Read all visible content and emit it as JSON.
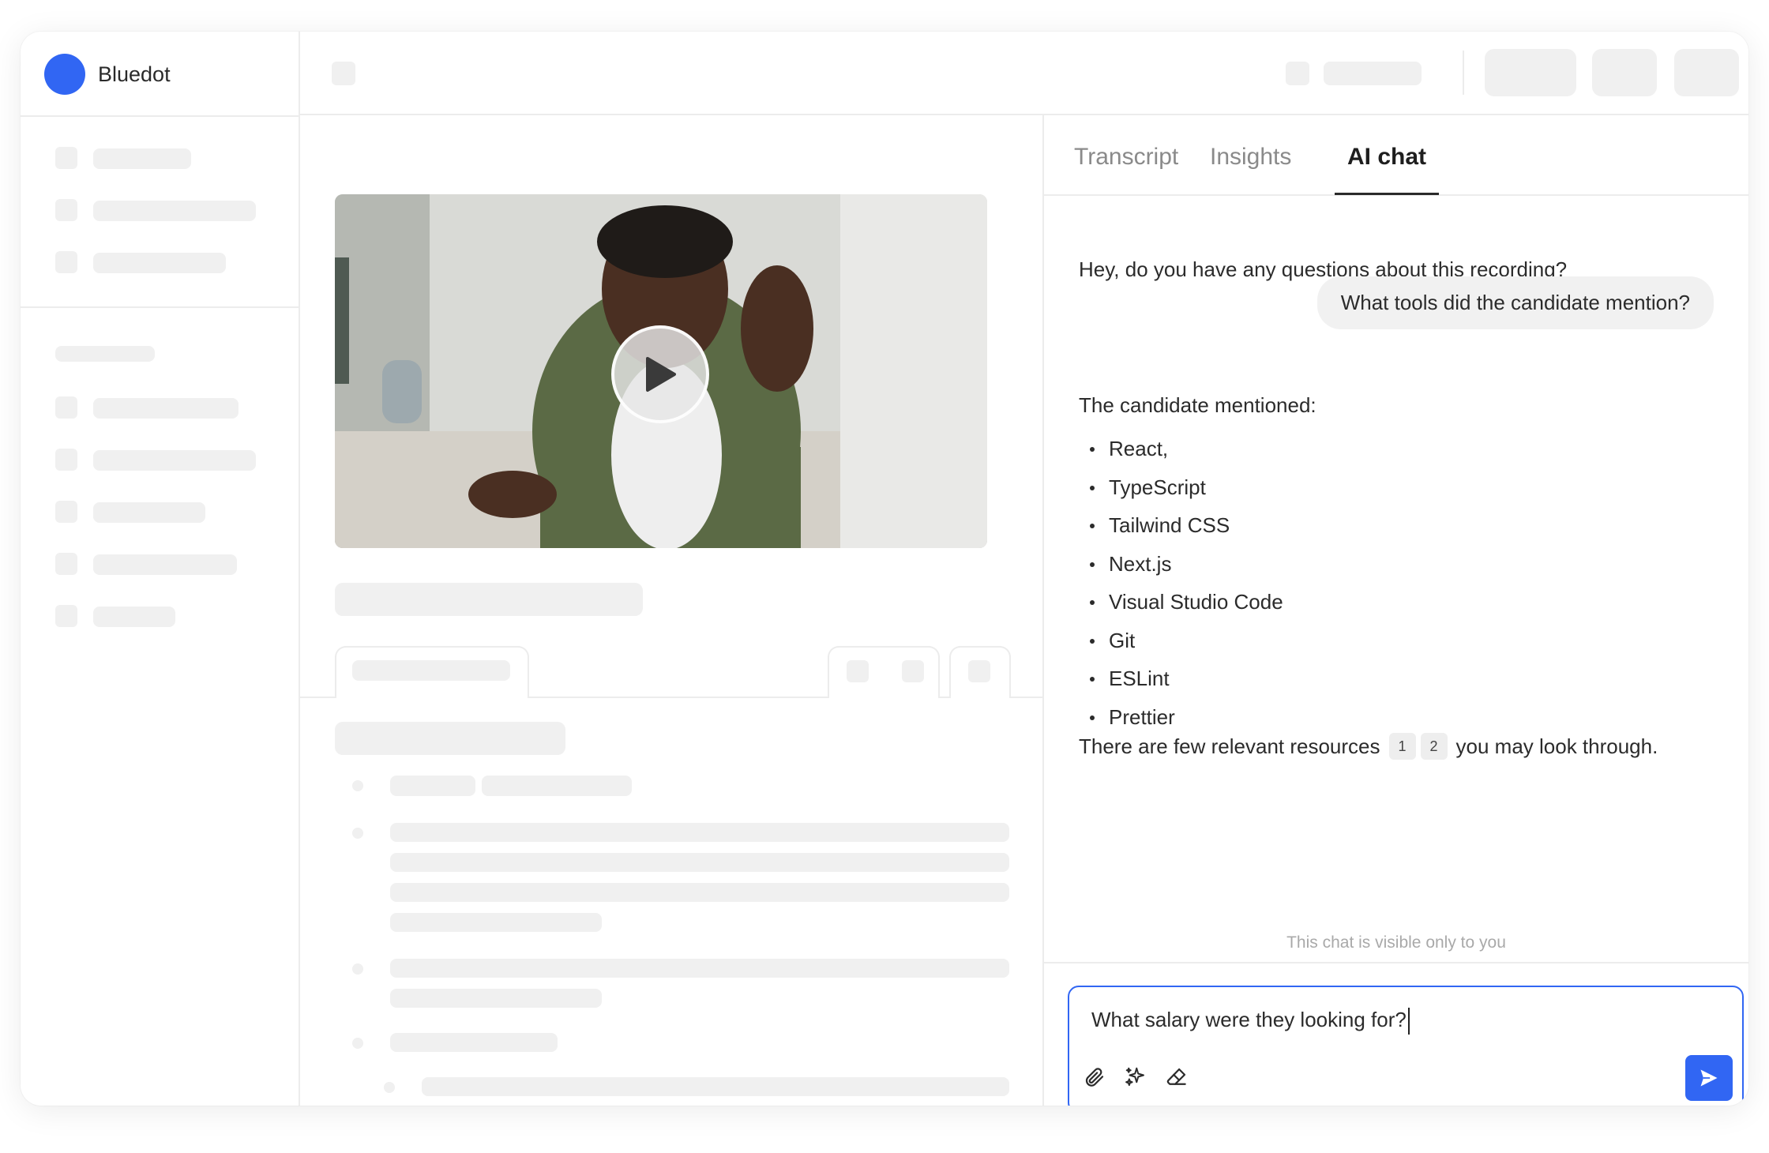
{
  "app": {
    "name": "Bluedot",
    "brand_color": "#3166f3"
  },
  "tabs": [
    {
      "label": "Transcript",
      "active": false
    },
    {
      "label": "Insights",
      "active": false
    },
    {
      "label": "AI chat",
      "active": true
    }
  ],
  "video": {
    "play_icon": "play-icon"
  },
  "chat": {
    "greeting": "Hey, do you have any questions about this recording?",
    "user_question": "What tools did the candidate mention?",
    "answer_intro": "The candidate mentioned:",
    "tools": [
      "React,",
      "TypeScript",
      "Tailwind CSS",
      "Next.js",
      "Visual Studio Code",
      "Git",
      "ESLint",
      "Prettier"
    ],
    "resources_before": "There are few relevant resources",
    "resource_refs": [
      "1",
      "2"
    ],
    "resources_after": "you may look through.",
    "visibility_note": "This chat is visible only to you"
  },
  "composer": {
    "value": "What salary were they looking for?",
    "tools": [
      "paperclip-icon",
      "sparkles-icon",
      "eraser-icon"
    ],
    "send_icon": "send-icon"
  }
}
